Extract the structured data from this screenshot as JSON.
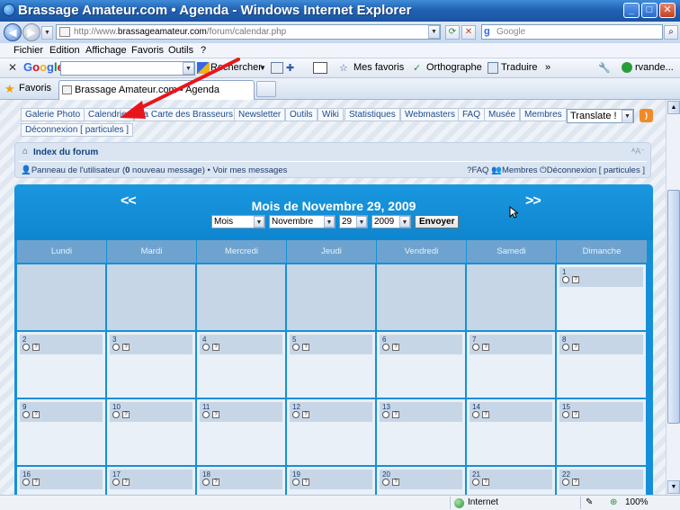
{
  "window": {
    "title": "Brassage Amateur.com • Agenda - Windows Internet Explorer",
    "minimize": "_",
    "maximize": "□",
    "close": "✕"
  },
  "address": {
    "url_prefix": "http://www.",
    "url_domain": "brassageamateur.com",
    "url_path": "/forum/calendar.php",
    "search_placeholder": "Google",
    "search_logo": "g"
  },
  "menu": [
    "Fichier",
    "Edition",
    "Affichage",
    "Favoris",
    "Outils",
    "?"
  ],
  "google_toolbar": {
    "close": "✕",
    "logo": "Google",
    "search_label": "Rechercher",
    "favorites_label": "Mes favoris",
    "spelling_label": "Orthographe",
    "translate_label": "Traduire",
    "more": "»",
    "user_label": "rvande..."
  },
  "favbar": {
    "favorites_label": "Favoris",
    "tab_label": "Brassage Amateur.com • Agenda"
  },
  "site_nav": {
    "links": [
      "Galerie Photo",
      "Calendrier",
      "La Carte des Brasseurs",
      "Newsletter",
      "Outils",
      "Wiki",
      "Statistiques",
      "Webmasters",
      "FAQ",
      "Musée",
      "Membres"
    ],
    "logout": "Déconnexion [ particules ]",
    "translate_select": "Translate !",
    "rss": "rss"
  },
  "forum_bar": {
    "index_label": "Index du forum",
    "font_size": "ᴬA⁻",
    "user_panel_prefix": "Panneau de l'utilisateur (",
    "new_messages_count": "0",
    "user_panel_suffix": " nouveau message) • Voir mes messages",
    "faq": "FAQ",
    "members": "Membres",
    "logout": "Déconnexion [ particules ]"
  },
  "calendar": {
    "prev": "<<",
    "next": ">>",
    "title": "Mois de Novembre 29, 2009",
    "view_select": "Mois",
    "month_select": "Novembre",
    "day_select": "29",
    "year_select": "2009",
    "submit": "Envoyer",
    "weekdays": [
      "Lundi",
      "Mardi",
      "Mercredi",
      "Jeudi",
      "Vendredi",
      "Samedi",
      "Dimanche"
    ],
    "weeks": [
      [
        "",
        "",
        "",
        "",
        "",
        "",
        "1"
      ],
      [
        "2",
        "3",
        "4",
        "5",
        "6",
        "7",
        "8"
      ],
      [
        "9",
        "10",
        "11",
        "12",
        "13",
        "14",
        "15"
      ],
      [
        "16",
        "17",
        "18",
        "19",
        "20",
        "21",
        "22"
      ]
    ]
  },
  "status": {
    "zone": "Internet",
    "zoom": "100%"
  },
  "colors": {
    "calendar_blue": "#1590d8",
    "annotation_arrow": "#e8161b"
  }
}
